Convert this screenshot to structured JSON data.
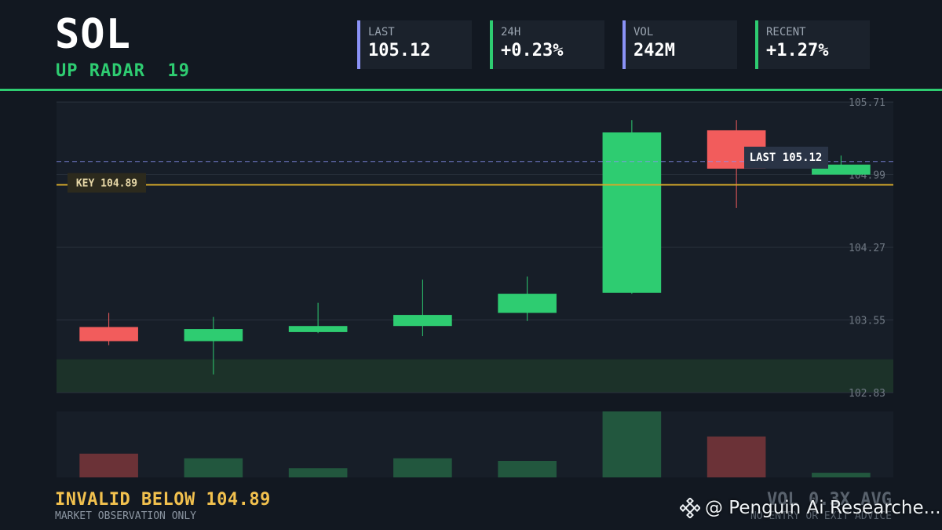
{
  "header": {
    "ticker": "SOL",
    "subtitle": "UP RADAR  19",
    "stats": [
      {
        "label": "LAST",
        "value": "105.12",
        "accent": "#8b93f7"
      },
      {
        "label": "24H",
        "value": "+0.23%",
        "accent": "#2ecc71"
      },
      {
        "label": "VOL",
        "value": "242M",
        "accent": "#8b93f7"
      },
      {
        "label": "RECENT",
        "value": "+1.27%",
        "accent": "#2ecc71"
      }
    ]
  },
  "chart_data": {
    "type": "candlestick",
    "ylim": [
      102.83,
      105.71
    ],
    "y_ticks": [
      "105.71",
      "104.99",
      "104.27",
      "103.55",
      "102.83"
    ],
    "candles": [
      {
        "open": 103.48,
        "close": 103.34,
        "high": 103.62,
        "low": 103.3
      },
      {
        "open": 103.34,
        "close": 103.46,
        "high": 103.58,
        "low": 103.01
      },
      {
        "open": 103.43,
        "close": 103.49,
        "high": 103.72,
        "low": 103.42
      },
      {
        "open": 103.49,
        "close": 103.6,
        "high": 103.95,
        "low": 103.39
      },
      {
        "open": 103.62,
        "close": 103.81,
        "high": 103.98,
        "low": 103.54
      },
      {
        "open": 103.82,
        "close": 105.41,
        "high": 105.53,
        "low": 103.81
      },
      {
        "open": 105.43,
        "close": 105.05,
        "high": 105.53,
        "low": 104.66
      },
      {
        "open": 104.99,
        "close": 105.09,
        "high": 105.18,
        "low": 104.99
      }
    ],
    "volumes": [
      0.36,
      0.29,
      0.14,
      0.29,
      0.25,
      1.0,
      0.62,
      0.07
    ],
    "last_price": 105.12,
    "last_label": "LAST 105.12",
    "key_level": 104.89,
    "key_label": "KEY 104.89",
    "support_zone": [
      102.83,
      103.16
    ],
    "colors": {
      "up": "#2ecc71",
      "down": "#f25c5c",
      "key": "#d4a82a",
      "last": "#8b93f7"
    }
  },
  "footer": {
    "invalid": "INVALID BELOW 104.89",
    "note": "MARKET OBSERVATION ONLY",
    "vol_avg": "VOL 0.3X AVG",
    "advice": "NO ENTRY OR EXIT ADVICE"
  },
  "watermark": {
    "text": "@ Penguin Ai Researche...",
    "icon": "binance-logo-icon"
  }
}
